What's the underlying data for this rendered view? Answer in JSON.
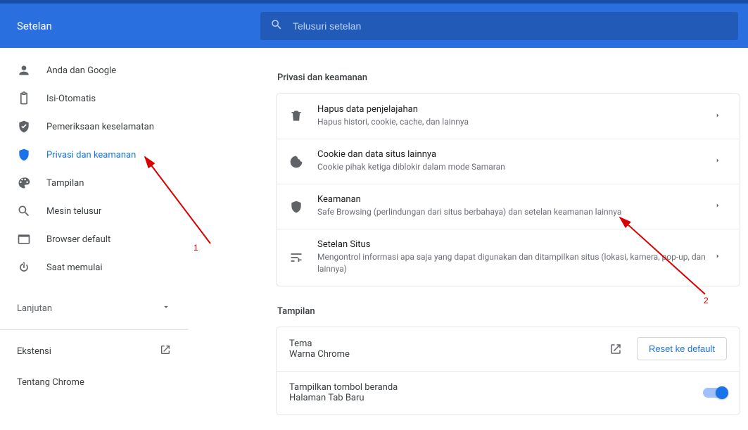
{
  "header": {
    "title": "Setelan",
    "search_placeholder": "Telusuri setelan"
  },
  "sidebar": {
    "items": [
      {
        "label": "Anda dan Google"
      },
      {
        "label": "Isi-Otomatis"
      },
      {
        "label": "Pemeriksaan keselamatan"
      },
      {
        "label": "Privasi dan keamanan"
      },
      {
        "label": "Tampilan"
      },
      {
        "label": "Mesin telusur"
      },
      {
        "label": "Browser default"
      },
      {
        "label": "Saat memulai"
      }
    ],
    "advanced_label": "Lanjutan",
    "extensions_label": "Ekstensi",
    "about_label": "Tentang Chrome"
  },
  "sections": {
    "privacy": {
      "title": "Privasi dan keamanan",
      "rows": [
        {
          "title": "Hapus data penjelajahan",
          "desc": "Hapus histori, cookie, cache, dan lainnya"
        },
        {
          "title": "Cookie dan data situs lainnya",
          "desc": "Cookie pihak ketiga diblokir dalam mode Samaran"
        },
        {
          "title": "Keamanan",
          "desc": "Safe Browsing (perlindungan dari situs berbahaya) dan setelan keamanan lainnya"
        },
        {
          "title": "Setelan Situs",
          "desc": "Mengontrol informasi apa saja yang dapat digunakan dan ditampilkan situs (lokasi, kamera, pop-up, dan lainnya)"
        }
      ]
    },
    "appearance": {
      "title": "Tampilan",
      "theme_label": "Tema",
      "theme_value": "Warna Chrome",
      "reset_label": "Reset ke default",
      "home_button_label": "Tampilkan tombol beranda",
      "home_button_value": "Halaman Tab Baru"
    }
  },
  "annotations": {
    "one": "1",
    "two": "2"
  }
}
